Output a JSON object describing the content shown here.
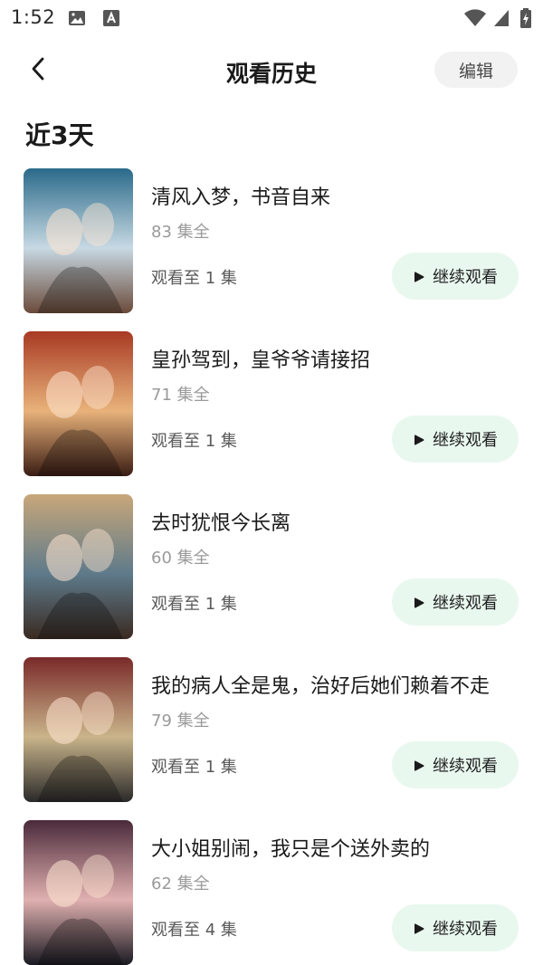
{
  "status_bar": {
    "time": "1:52",
    "icons": [
      "image-icon",
      "text-a-icon",
      "wifi-icon",
      "signal-icon",
      "battery-charging-icon"
    ]
  },
  "header": {
    "back_icon": "chevron-left-icon",
    "title": "观看历史",
    "edit_label": "编辑"
  },
  "section": {
    "title": "近3天"
  },
  "items": [
    {
      "title": "清风入梦，书音自来",
      "episodes": "83 集全",
      "progress": "观看至 1 集",
      "action": "继续观看",
      "poster_colors": [
        "#2a6a8a",
        "#c7d9e3",
        "#6b4a3a"
      ]
    },
    {
      "title": "皇孙驾到，皇爷爷请接招",
      "episodes": "71 集全",
      "progress": "观看至 1 集",
      "action": "继续观看",
      "poster_colors": [
        "#a83a24",
        "#e8b27a",
        "#3a1c14"
      ]
    },
    {
      "title": "去时犹恨今长离",
      "episodes": "60 集全",
      "progress": "观看至 1 集",
      "action": "继续观看",
      "poster_colors": [
        "#c8a77a",
        "#5e7a8a",
        "#3a2a22"
      ]
    },
    {
      "title": "我的病人全是鬼，治好后她们赖着不走",
      "episodes": "79 集全",
      "progress": "观看至 1 集",
      "action": "继续观看",
      "poster_colors": [
        "#7a2a2a",
        "#c9b48a",
        "#2a2a2a"
      ]
    },
    {
      "title": "大小姐别闹，我只是个送外卖的",
      "episodes": "62 集全",
      "progress": "观看至 4 集",
      "action": "继续观看",
      "poster_colors": [
        "#4a2a3a",
        "#e0b0b0",
        "#1a1a22"
      ]
    }
  ],
  "accent": {
    "continue_bg": "#e9f8ef",
    "edit_bg": "#f2f2f2"
  }
}
